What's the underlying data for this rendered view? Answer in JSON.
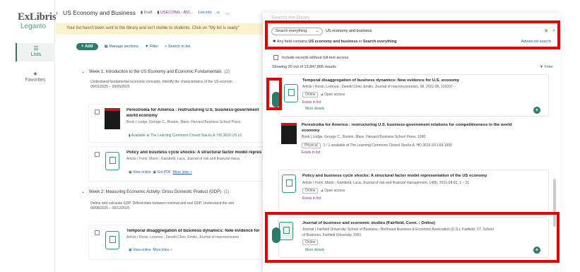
{
  "rail": {
    "logo_line1": "ExLibris",
    "logo_line2": "Leganto",
    "items": [
      {
        "label": "Lists",
        "icon": "list-icon"
      },
      {
        "label": "Favorites",
        "icon": "star-icon"
      }
    ]
  },
  "header": {
    "title": "US Economy and Business",
    "draft": "Draft",
    "course": "USECONG - A51...",
    "list_info": "List info"
  },
  "banner": "Your list hasn't been sent to the library and isn't visible to students. Click on \"My list is ready\"",
  "toolbar": {
    "add": "+ Add",
    "manage": "Manage sections",
    "filter": "Filter",
    "search": "Search in list"
  },
  "weeks": [
    {
      "title": "Week 1: Introduction to the US Economy and Economic Fundamentals",
      "count": "(2)",
      "desc": "Understand fundamental economic concepts. Identify the characteristics of the US econom",
      "dates": "09/01/2025 – 09/05/2025"
    },
    {
      "title": "Week 2: Measuring Economic Activity: Gross Domestic Product (GDP)",
      "count": "(1)",
      "desc": "Define and calculate GDP. Differentiate between nominal and real GDP. Understand the stre",
      "dates": "09/08/2025 – 09/12/2025"
    }
  ],
  "list_items": [
    {
      "title": "Perestroika for America : restructuring U.S. business-government",
      "title2": "world economy",
      "meta": "Book | Lodge, George C., Boston, Mass. Harvard Business School Press,",
      "avail": "Available at The Learning Commons Closed Stacks A: HD 3616 US L6"
    },
    {
      "title": "Policy and business cycle shocks: A structural factor model repres",
      "meta": "Article | Forni, Mario ; Gambetti, Luca, Journal of risk and financial mana",
      "view": "View online",
      "pdf": "Get PDF",
      "more": "More links >"
    },
    {
      "title": "Temporal disaggregation of business dynamics: New evidence for",
      "meta": "Article | Rossi, Lorenza ; Zanetti Chini, Emilio, Journal of macroeconomi",
      "view": "View online",
      "more": "More links >"
    }
  ],
  "search": {
    "panel_title": "Search the library",
    "scope": "Search everything",
    "query": "US economy and business",
    "hint_prefix": "Any field contains",
    "hint_query": "US economy and business",
    "hint_in": "in",
    "hint_scope": "Search everything",
    "advanced": "Advanced search",
    "include_label": "Include records without full-text access",
    "results_count": "Showing 20 out of 13,847,805 results",
    "filter": "Filter"
  },
  "results": [
    {
      "title": "Temporal disaggregation of business dynamics: New evidence for U.S. economy",
      "meta": "Article | Rossi, Lorenza ; Zanetti Chini, Emilio, Journal of macroeconomics, 68, 2021-06, 103337 –",
      "online": "Online",
      "oa": "Open access",
      "exists": "Exists in list",
      "more": "More details"
    },
    {
      "title": "Perestroika for America : restructuring U.S. business-government relations for competitiveness in the world",
      "title2": "economy",
      "meta": "Book | Lodge, George C., Boston, Mass. Harvard Business School Press, 1990",
      "physical": "Physical",
      "phys_detail": "1 / 1 available at The Learning Commons Closed Stacks A: HD 3616 US L64 1990",
      "exists": "Exists in list"
    },
    {
      "title": "Policy and business cycle shocks: A structural factor model representation of the US economy",
      "meta": "Article | Forni, Mario ; Gambetti, Luca, Journal of risk and financial management, 14(8), 2021-08-01, 1 – 21",
      "online": "Online",
      "oa": "Open access",
      "exists": "Exists in list"
    },
    {
      "title": "Journal of business and economic studies (Fairfield, Conn. : Online)",
      "meta": "Journal | Fairfield University. School of Business.; Northeast Business & Economic Association (U.S.), Fairfield, CT. School",
      "meta2": "of Business, Fairfield University, 1991",
      "online": "Online",
      "more": "More details"
    }
  ],
  "colors": {
    "accent": "#2c7a6a",
    "highlight": "#e00000",
    "banner": "#fdf2cf"
  }
}
